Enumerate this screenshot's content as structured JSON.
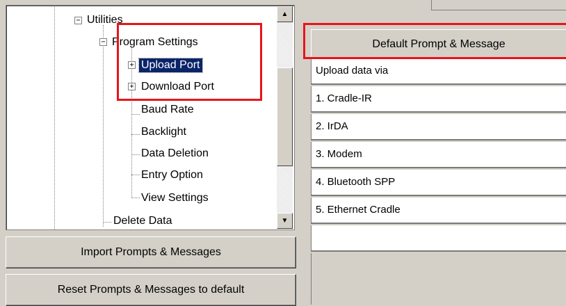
{
  "tree": {
    "nodes": [
      {
        "label": "Utilities"
      },
      {
        "label": "Program Settings"
      },
      {
        "label": "Upload Port"
      },
      {
        "label": "Download Port"
      },
      {
        "label": "Baud Rate"
      },
      {
        "label": "Backlight"
      },
      {
        "label": "Data Deletion"
      },
      {
        "label": "Entry Option"
      },
      {
        "label": "View Settings"
      },
      {
        "label": "Delete Data"
      }
    ],
    "selected": "Upload Port"
  },
  "buttons": {
    "import": "Import Prompts & Messages",
    "reset": "Reset Prompts & Messages to default"
  },
  "grid": {
    "header": "Default Prompt & Message",
    "rows": [
      "Upload data via",
      "1. Cradle-IR",
      "2. IrDA",
      "3. Modem",
      "4. Bluetooth SPP",
      "5. Ethernet Cradle",
      ""
    ]
  },
  "icons": {
    "expand": "plus-box-icon",
    "collapse": "minus-box-icon",
    "scroll_up": "arrow-up-icon",
    "scroll_down": "arrow-down-icon"
  },
  "colors": {
    "highlight_box": "#e8141b",
    "selection": "#0a246a",
    "chrome": "#d4d0c8"
  }
}
